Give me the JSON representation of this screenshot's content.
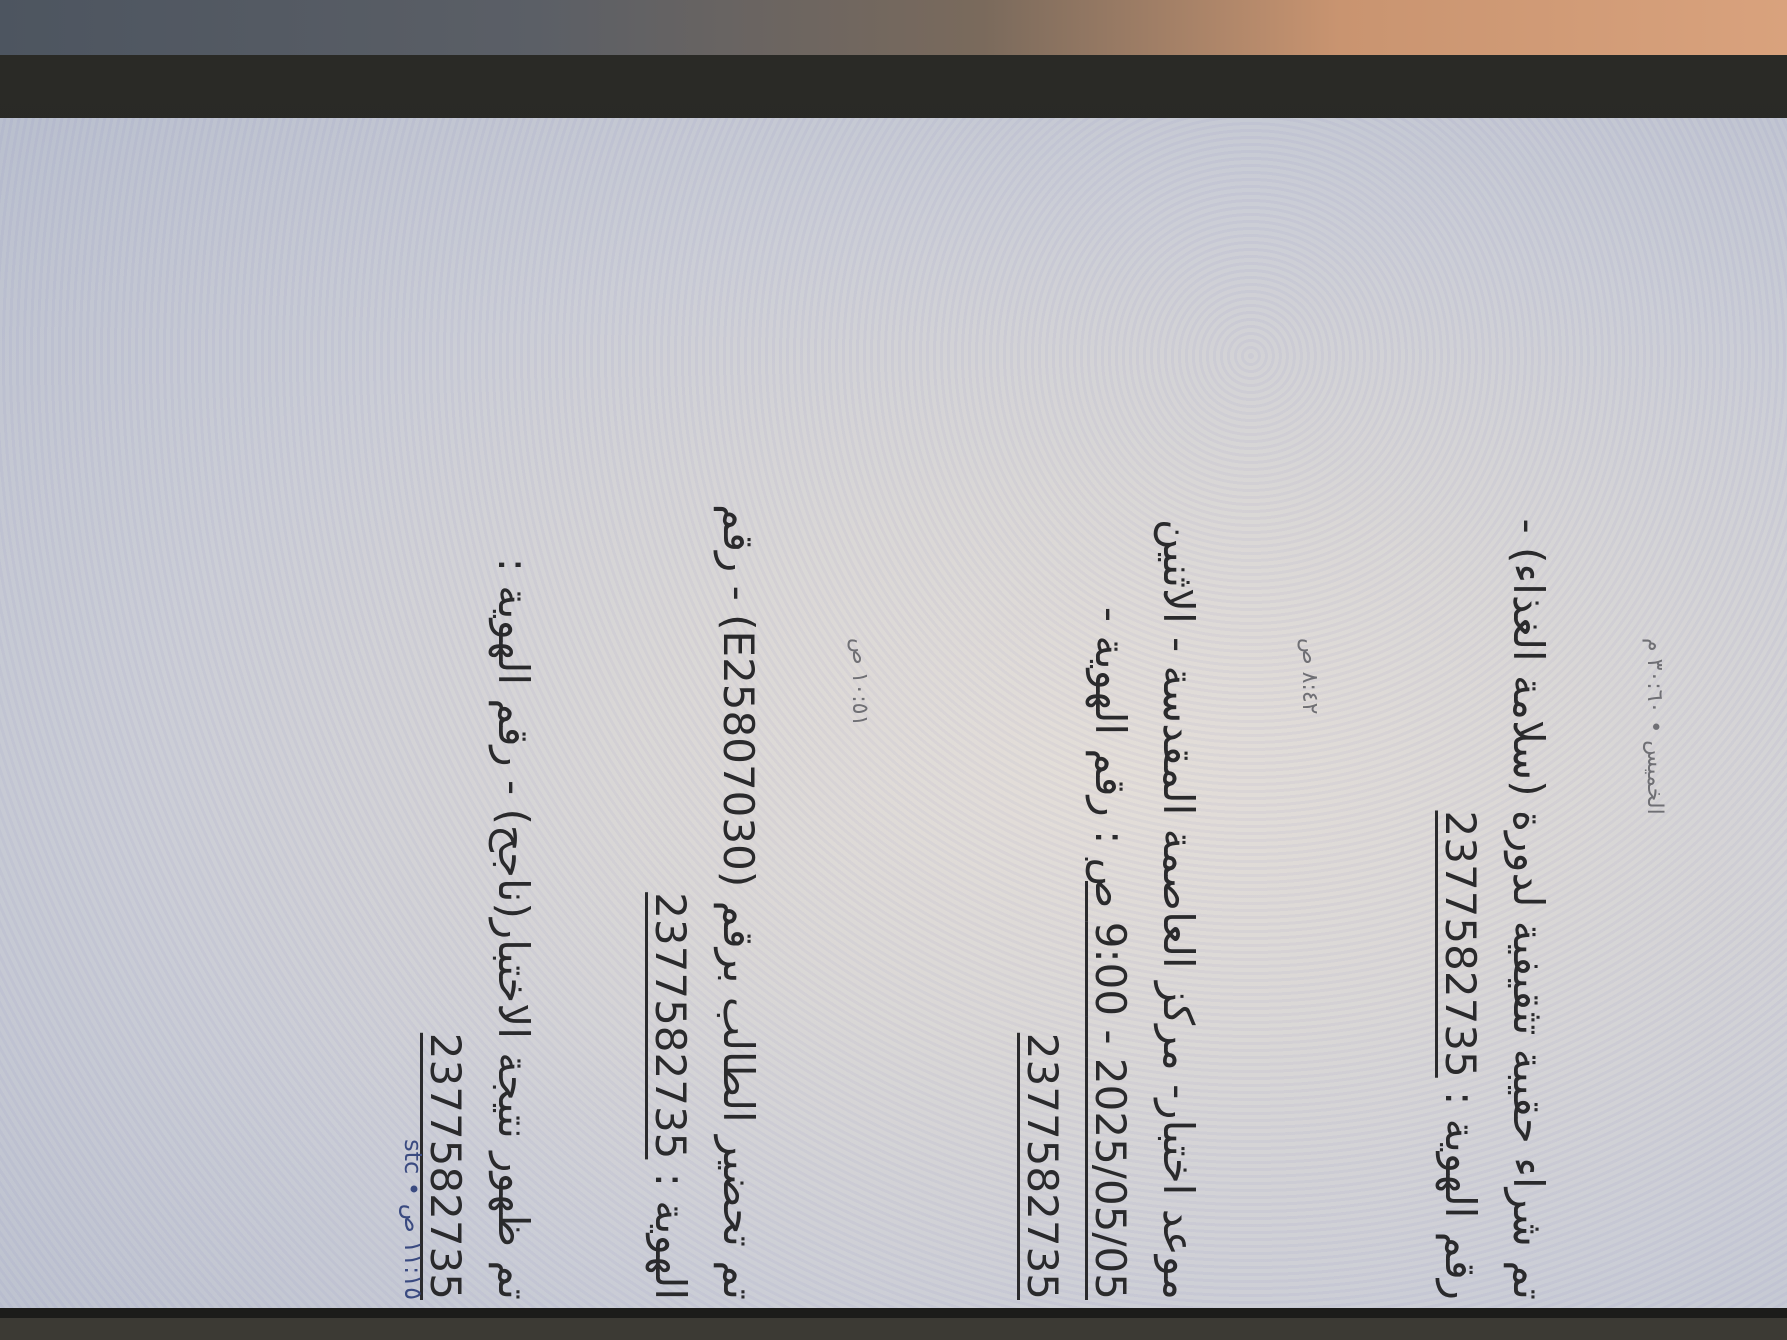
{
  "messages": [
    {
      "timestamp": "الخميس • ٣٠:٦٠ م",
      "line1": "تم شراء حقيبة تثقيفية لدورة (سلامة الغذاء) -",
      "line2_prefix": "رقم الهوية :",
      "line2_id": "2377582735"
    },
    {
      "timestamp": "٨:٤٢ ص",
      "line1": "موعد اختبار- مركز العاصمة المقدسة - الاثنين",
      "line2_prefix": ": رقم الهوية -",
      "line2_date": "2025/05/05 - 9:00 ص",
      "line3_id": "2377582735"
    },
    {
      "timestamp": "١٠:٥١ ص",
      "line1": "تم تحضير الطالب برقم (E25807030) - رقم",
      "line2_prefix": "الهوية :",
      "line2_id": "2377582735"
    },
    {
      "timestamp": "",
      "line1": "تم ظهور نتيجة الاختبار(ناجح) - رقم الهوية :",
      "line2_id": "2377582735"
    }
  ],
  "footer": {
    "carrier": "stc",
    "time": "١١:١٥ ص"
  }
}
